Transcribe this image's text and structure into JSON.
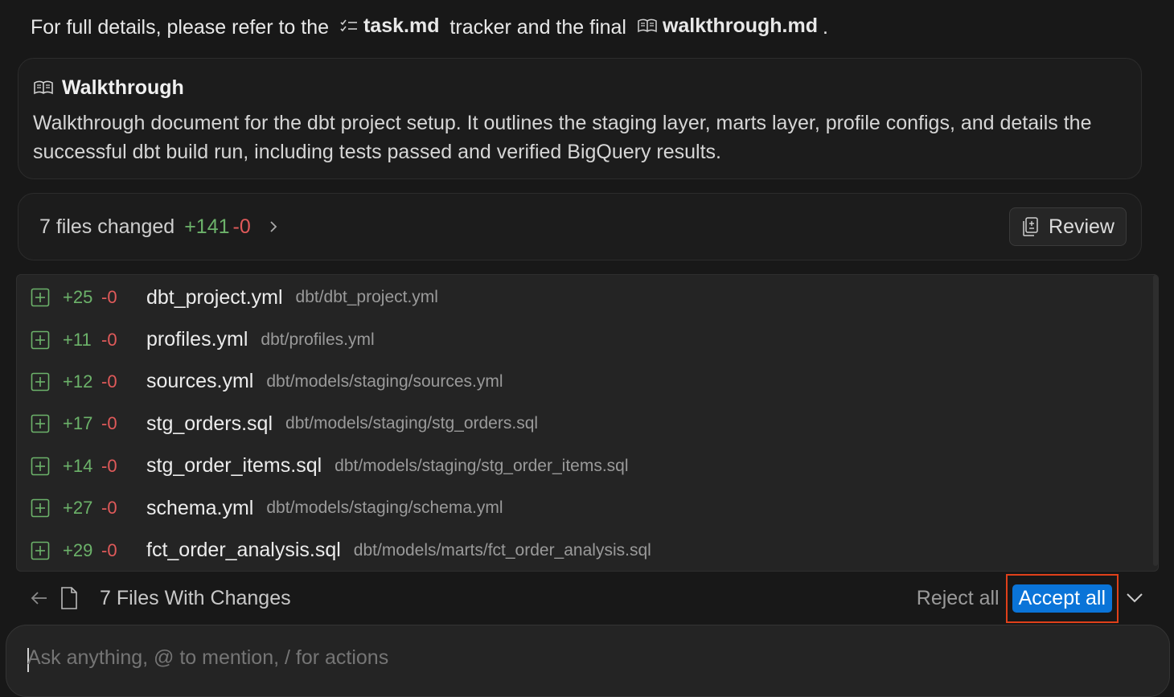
{
  "intro": {
    "text_before": "For full details, please refer to the",
    "task_file": "task.md",
    "text_middle": "tracker and the final",
    "walkthrough_file": "walkthrough.md",
    "text_after": "."
  },
  "walkthrough_card": {
    "icon": "book-icon",
    "title": "Walkthrough",
    "description": "Walkthrough document for the dbt project setup. It outlines the staging layer, marts layer, profile configs, and details the successful dbt build run, including tests passed and verified BigQuery results."
  },
  "changes_summary": {
    "label": "7 files changed",
    "additions": "+141",
    "deletions": "-0",
    "review_label": "Review"
  },
  "files": [
    {
      "add": "+25",
      "del": "-0",
      "name": "dbt_project.yml",
      "path": "dbt/dbt_project.yml"
    },
    {
      "add": "+11",
      "del": "-0",
      "name": "profiles.yml",
      "path": "dbt/profiles.yml"
    },
    {
      "add": "+12",
      "del": "-0",
      "name": "sources.yml",
      "path": "dbt/models/staging/sources.yml"
    },
    {
      "add": "+17",
      "del": "-0",
      "name": "stg_orders.sql",
      "path": "dbt/models/staging/stg_orders.sql"
    },
    {
      "add": "+14",
      "del": "-0",
      "name": "stg_order_items.sql",
      "path": "dbt/models/staging/stg_order_items.sql"
    },
    {
      "add": "+27",
      "del": "-0",
      "name": "schema.yml",
      "path": "dbt/models/staging/schema.yml"
    },
    {
      "add": "+29",
      "del": "-0",
      "name": "fct_order_analysis.sql",
      "path": "dbt/models/marts/fct_order_analysis.sql"
    }
  ],
  "action_bar": {
    "files_label": "7 Files With Changes",
    "reject_label": "Reject all",
    "accept_label": "Accept all"
  },
  "input": {
    "placeholder": "Ask anything, @ to mention, / for actions",
    "value": ""
  },
  "colors": {
    "accent": "#0a74d8",
    "additions": "#6cb26a",
    "deletions": "#e05a5a",
    "highlight": "#e0401a"
  }
}
